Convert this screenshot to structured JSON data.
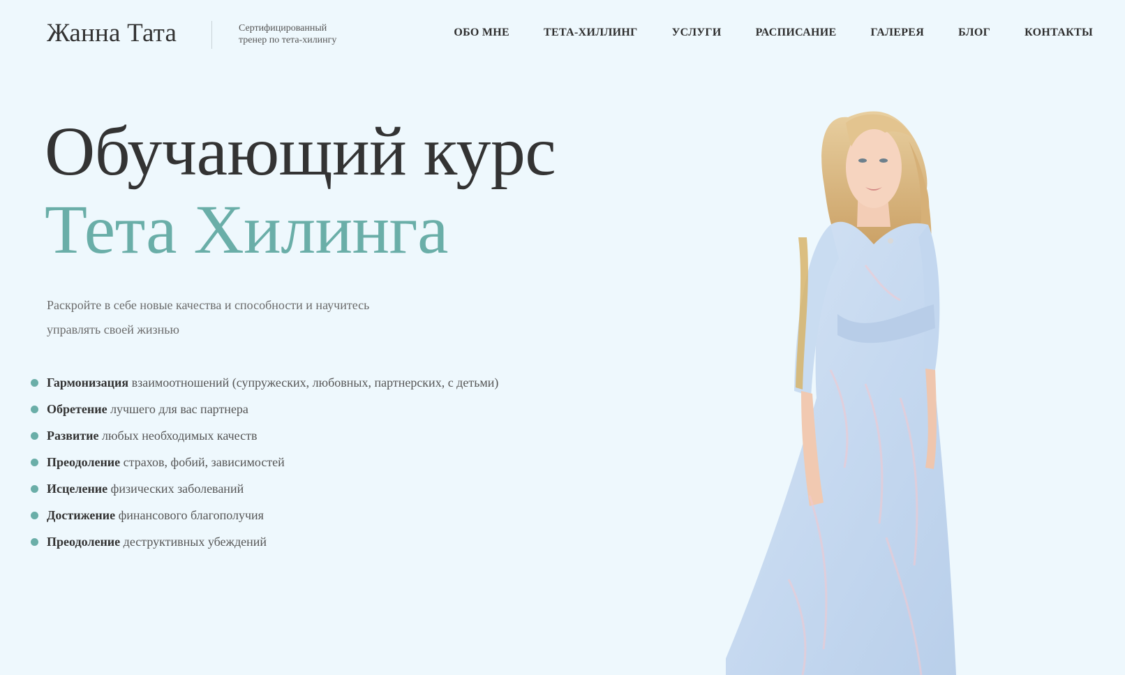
{
  "colors": {
    "background": "#eef8fd",
    "accent": "#6aaea8",
    "text": "#333333",
    "muted": "#6b6b6b",
    "dress": "#c9dcf1"
  },
  "header": {
    "brand_name": "Жанна Тата",
    "tagline_line1": "Сертифицированный",
    "tagline_line2": "тренер по тета-хилингу"
  },
  "nav": {
    "items": [
      {
        "label": "ОБО МНЕ"
      },
      {
        "label": "ТЕТА-ХИЛЛИНГ"
      },
      {
        "label": "УСЛУГИ"
      },
      {
        "label": "РАСПИСАНИЕ"
      },
      {
        "label": "ГАЛЕРЕЯ"
      },
      {
        "label": "БЛОГ"
      },
      {
        "label": "КОНТАКТЫ"
      }
    ]
  },
  "hero": {
    "title_line1": "Обучающий курс",
    "title_line2": "Тета Хилинга",
    "subtitle_line1": "Раскройте в себе новые качества и способности и научитесь",
    "subtitle_line2": "управлять своей жизнью",
    "benefits": [
      {
        "bold": "Гармонизация",
        "rest": " взаимоотношений (супружеских, любовных, партнерских, с детьми)"
      },
      {
        "bold": "Обретение",
        "rest": " лучшего для вас партнера"
      },
      {
        "bold": "Развитие",
        "rest": " любых необходимых качеств"
      },
      {
        "bold": "Преодоление",
        "rest": " страхов, фобий, зависимостей"
      },
      {
        "bold": "Исцеление",
        "rest": " физических заболеваний"
      },
      {
        "bold": "Достижение",
        "rest": " финансового благополучия"
      },
      {
        "bold": "Преодоление",
        "rest": " деструктивных убеждений"
      }
    ]
  }
}
